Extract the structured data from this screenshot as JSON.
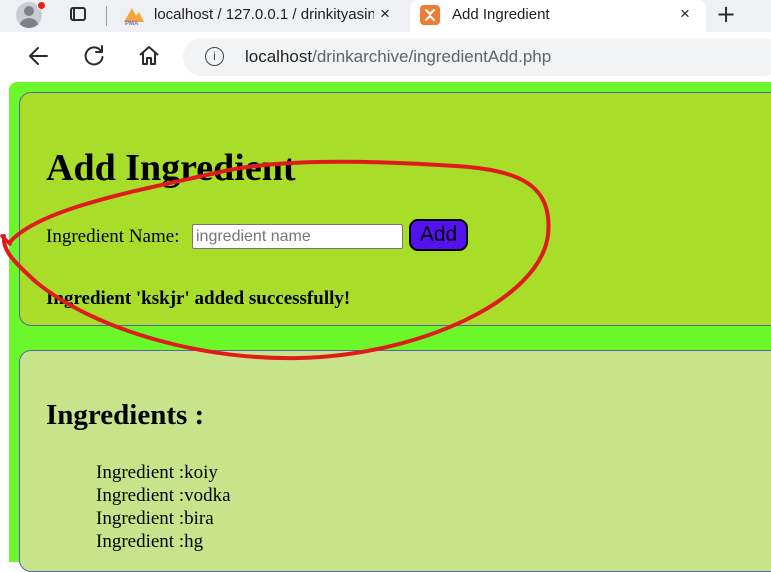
{
  "browser": {
    "tabs": [
      {
        "title": "localhost / 127.0.0.1 / drinkityasin",
        "favicon": "phpmyadmin-icon",
        "active": false
      },
      {
        "title": "Add Ingredient",
        "favicon": "xampp-icon",
        "active": true
      }
    ],
    "close_glyph": "×",
    "new_tab_glyph": "+",
    "address": {
      "host": "localhost",
      "path": "/drinkarchive/ingredientAdd.php"
    }
  },
  "form": {
    "heading": "Add Ingredient",
    "label": "Ingredient Name:",
    "input_value": "",
    "input_placeholder": "ingredient name",
    "button_label": "Add",
    "success_message": "Ingredient 'kskjr' added successfully!"
  },
  "list": {
    "heading": "Ingredients :",
    "items": [
      "Ingredient :koiy",
      "Ingredient :vodka",
      "Ingredient :bira",
      "Ingredient :hg"
    ]
  },
  "colors": {
    "page_bg": "#6cf72a",
    "form_panel": "#a8de2a",
    "list_panel": "#c8e48a",
    "button": "#5512f0",
    "annotation": "#e01b1b"
  }
}
